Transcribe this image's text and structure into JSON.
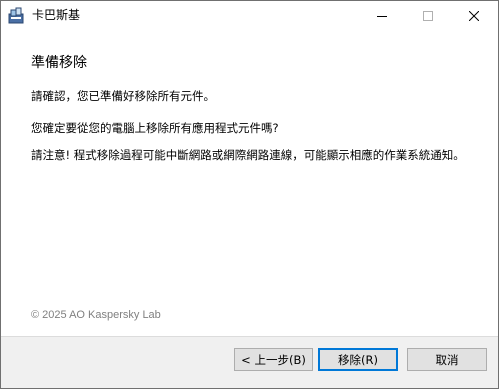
{
  "window": {
    "title": "卡巴斯基"
  },
  "content": {
    "heading": "準備移除",
    "paragraph1": "請確認，您已準備好移除所有元件。",
    "paragraph2": "您確定要從您的電腦上移除所有應用程式元件嗎?",
    "paragraph3": "請注意! 程式移除過程可能中斷網路或網際網路連線，可能顯示相應的作業系統通知。",
    "copyright": "© 2025 AO Kaspersky Lab"
  },
  "buttons": {
    "back": "< 上一步(B)",
    "remove": "移除(R)",
    "cancel": "取消"
  },
  "icons": {
    "app": "kaspersky-installer-icon",
    "minimize": "minimize-icon",
    "maximize": "maximize-icon",
    "close": "close-icon"
  },
  "colors": {
    "default_button_border": "#0078d7",
    "footer_background": "#f0f0f0",
    "copyright_text": "#808080"
  }
}
